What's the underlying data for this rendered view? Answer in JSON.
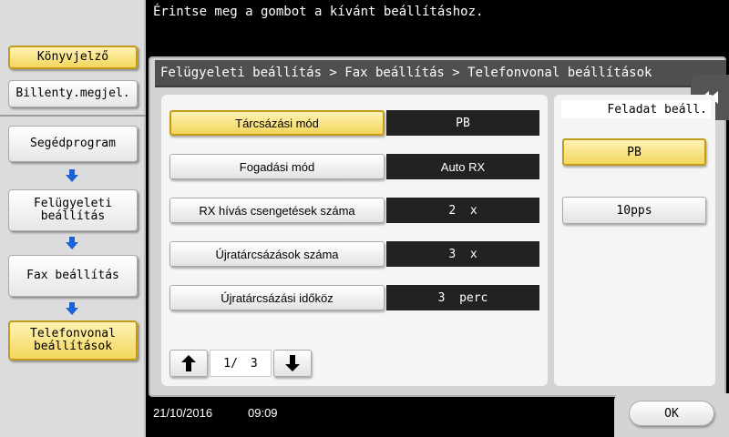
{
  "message": "Érintse meg a gombot a kívánt beállításhoz.",
  "sidebar": {
    "bookmark": "Könyvjelző",
    "keyboard": "Billenty.megjel.",
    "path": [
      {
        "label": "Segédprogram"
      },
      {
        "label": "Felügyeleti\nbeállítás"
      },
      {
        "label": "Fax beállítás"
      },
      {
        "label": "Telefonvonal\nbeállítások"
      }
    ]
  },
  "breadcrumb": "Felügyeleti beállítás > Fax beállítás > Telefonvonal beállítások",
  "rows": [
    {
      "label": "Tárcsázási mód",
      "value": "PB"
    },
    {
      "label": "Fogadási mód",
      "value": "Auto RX"
    },
    {
      "label": "RX hívás csengetések száma",
      "value": "2  x"
    },
    {
      "label": "Újratárcsázások száma",
      "value": "3  x"
    },
    {
      "label": "Újratárcsázási időköz",
      "value": "3  perc"
    }
  ],
  "pager": {
    "current": "1/",
    "total": "3"
  },
  "right_panel": {
    "title": "Feladat beáll.",
    "options": [
      "PB",
      "10pps"
    ]
  },
  "footer": {
    "date": "21/10/2016",
    "time": "09:09",
    "ok_label": "OK"
  },
  "colors": {
    "accent": "#f2d65c",
    "value_bg": "#222222",
    "arrow_blue": "#1b62d6"
  }
}
